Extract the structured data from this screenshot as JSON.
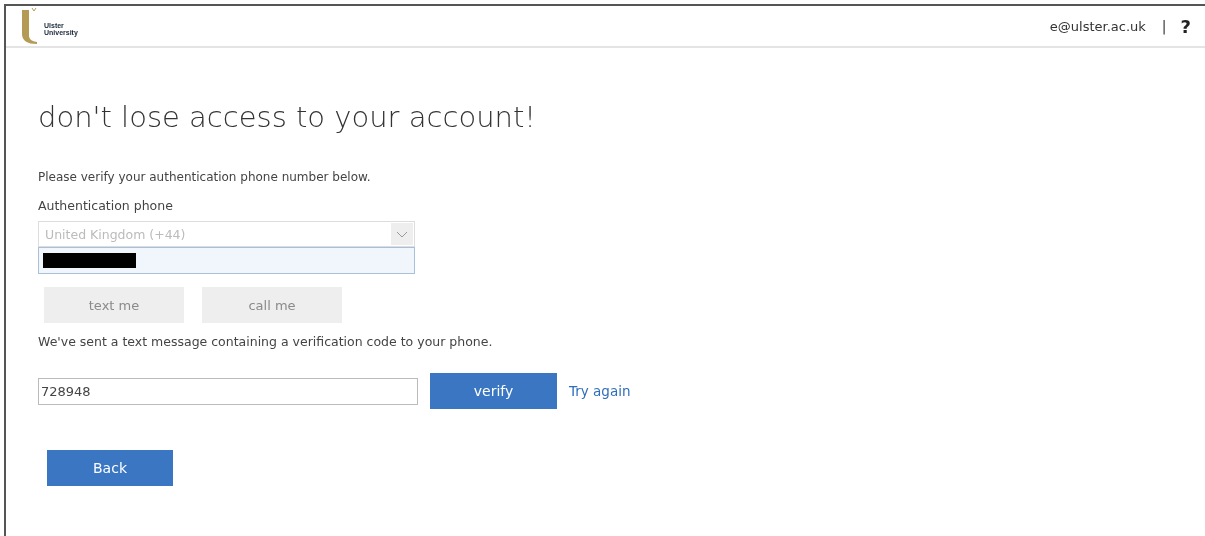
{
  "header": {
    "logo_text": "Ulster University",
    "user": "e@ulster.ac.uk",
    "separator": "|",
    "help": "?"
  },
  "title": "don't lose access to your account!",
  "instruction": "Please verify your authentication phone number below.",
  "phone": {
    "label": "Authentication phone",
    "country": {
      "value": "United Kingdom (+44)",
      "disabled": true
    },
    "number_redacted": true
  },
  "contact_buttons": [
    {
      "label": "text me",
      "disabled": true
    },
    {
      "label": "call me",
      "disabled": true
    }
  ],
  "message": "We've sent a text message containing a verification code to your phone.",
  "code_field": {
    "value": "728948"
  },
  "verify_button": "verify",
  "try_again_link": "Try again",
  "back_button": "Back"
}
